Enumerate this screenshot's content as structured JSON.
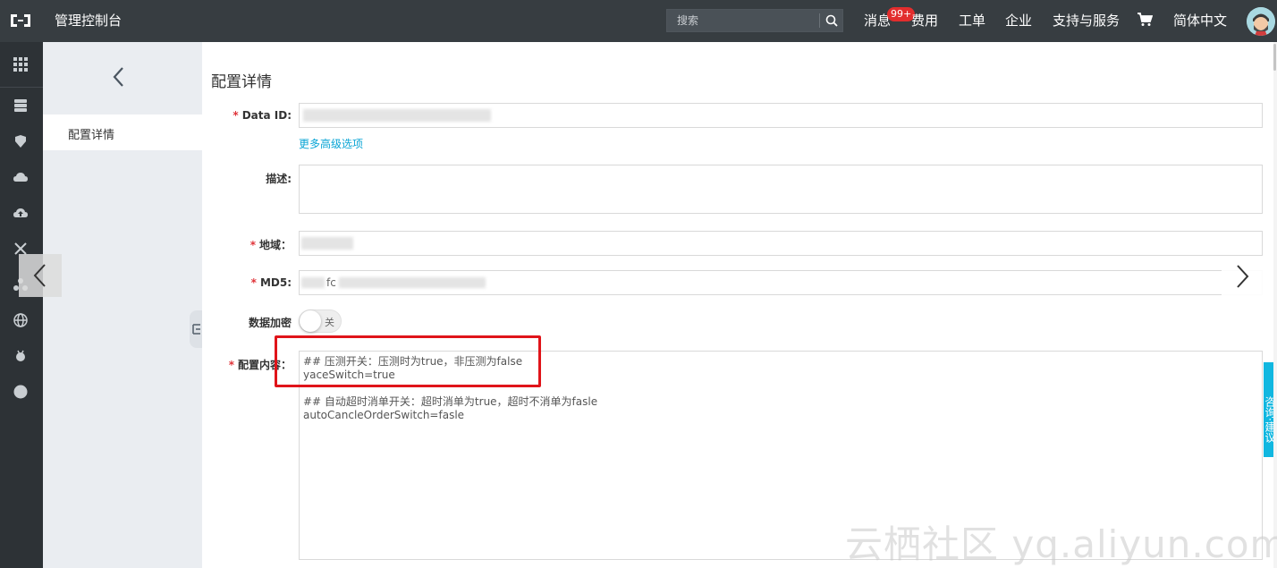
{
  "header": {
    "app_title": "管理控制台",
    "search_placeholder": "搜索",
    "nav": {
      "messages": "消息",
      "messages_badge": "99+",
      "billing": "费用",
      "tickets": "工单",
      "enterprise": "企业",
      "support": "支持与服务",
      "language": "简体中文"
    }
  },
  "subsidebar": {
    "active_item": "配置详情"
  },
  "main": {
    "page_title": "配置详情",
    "required_mark": "*",
    "data_id_label": "Data ID:",
    "advanced_link": "更多高级选项",
    "description_label": "描述:",
    "region_label": "地域：",
    "md5_label": "MD5:",
    "md5_partial": "fc",
    "encrypt_label": "数据加密",
    "encrypt_toggle_text": "关",
    "content_label": "配置内容：",
    "content_lines": [
      "## 压测开关：压测时为true，非压测为false",
      "yaceSwitch=true",
      "",
      "## 自动超时消单开关：超时消单为true，超时不消单为fasle",
      "autoCancleOrderSwitch=fasle"
    ]
  },
  "feedback_tab": "咨询·建议",
  "watermark": "云栖社区 yq.aliyun.com",
  "colors": {
    "topbar": "#373d41",
    "iconbar": "#2d3236",
    "subsidebar": "#eaedf1",
    "link": "#0aa5d5",
    "required": "#e0343a",
    "highlight": "#e0141a",
    "feedback": "#11b7e0"
  }
}
